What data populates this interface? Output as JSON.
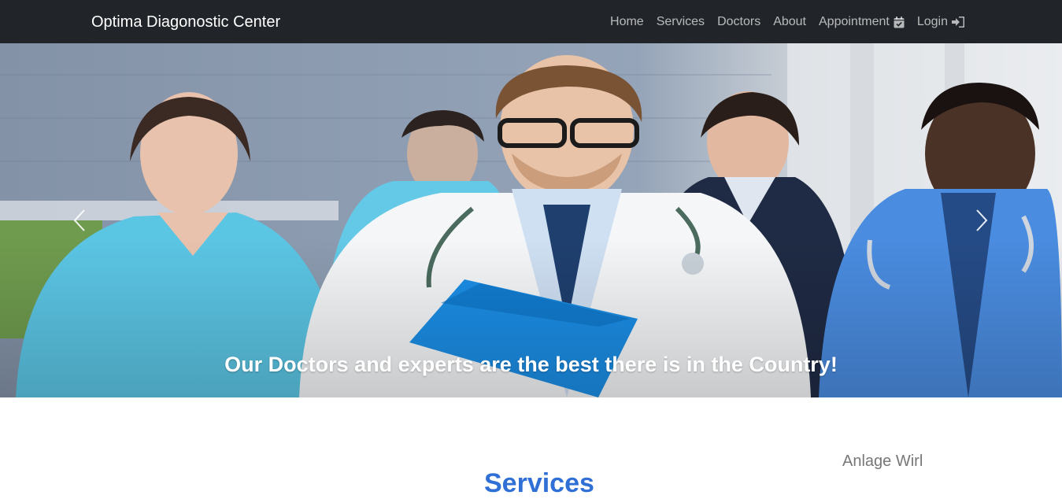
{
  "navbar": {
    "brand": "Optima Diagonostic Center",
    "links": [
      {
        "label": "Home",
        "icon": ""
      },
      {
        "label": "Services",
        "icon": ""
      },
      {
        "label": "Doctors",
        "icon": ""
      },
      {
        "label": "About",
        "icon": ""
      },
      {
        "label": "Appointment",
        "icon": "calendar-check-icon"
      },
      {
        "label": "Login",
        "icon": "sign-in-icon"
      }
    ]
  },
  "hero": {
    "caption": "Our Doctors and experts are the best there is in the Country!",
    "prev_icon": "chevron-left-icon",
    "next_icon": "chevron-right-icon"
  },
  "sections": {
    "services_title": "Services",
    "side_text": "Anlage Wirl"
  },
  "colors": {
    "navbar_bg": "#212529",
    "link": "#a9abad",
    "accent": "#2f6fd6"
  }
}
